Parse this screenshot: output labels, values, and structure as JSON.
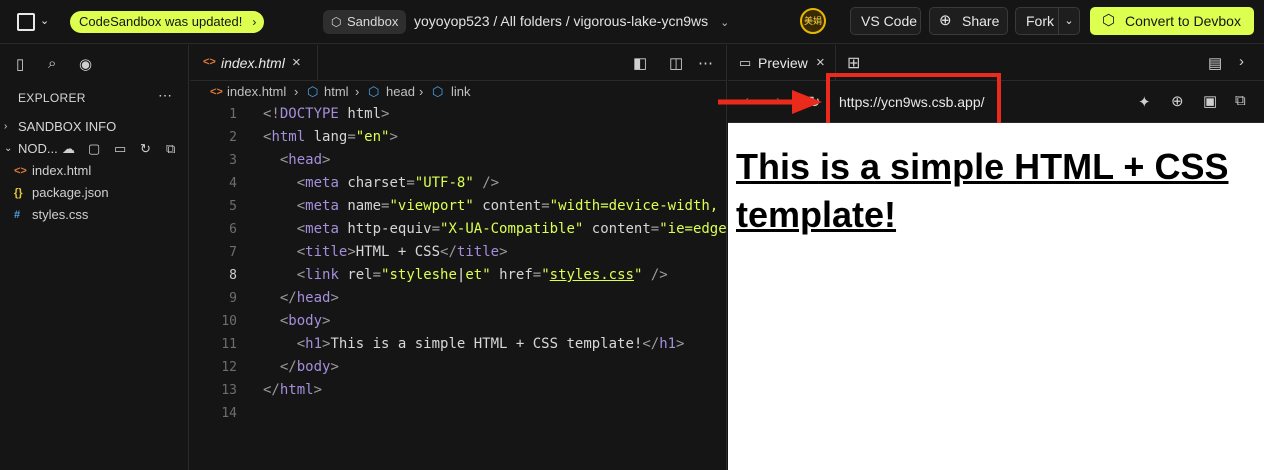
{
  "topbar": {
    "update_badge": "CodeSandbox was updated!",
    "sandbox_label": "Sandbox",
    "breadcrumb": "yoyoyop523  /  All folders  /  vigorous-lake-ycn9ws",
    "avatar_text": "美娟",
    "vscode_label": "VS Code",
    "share_label": "Share",
    "fork_label": "Fork",
    "convert_label": "Convert to Devbox"
  },
  "sidebar": {
    "explorer_title": "EXPLORER",
    "sandbox_info": "SANDBOX INFO",
    "node_section": "NOD...",
    "files": [
      {
        "name": "index.html",
        "icon": "<>",
        "color": "#e07a3c"
      },
      {
        "name": "package.json",
        "icon": "{}",
        "color": "#e8c83c"
      },
      {
        "name": "styles.css",
        "icon": "#",
        "color": "#4aa3e8"
      }
    ]
  },
  "editor": {
    "tab_label": "index.html",
    "breadcrumb": [
      "index.html",
      "html",
      "head",
      "link"
    ],
    "line_numbers": [
      "1",
      "2",
      "3",
      "4",
      "5",
      "6",
      "7",
      "8",
      "9",
      "10",
      "11",
      "12",
      "13",
      "14"
    ]
  },
  "preview": {
    "tab_label": "Preview",
    "url": "https://ycn9ws.csb.app/",
    "heading": "This is a simple HTML + CSS template!"
  },
  "colors": {
    "accent": "#dcff50",
    "highlight": "#ea2a1a"
  }
}
